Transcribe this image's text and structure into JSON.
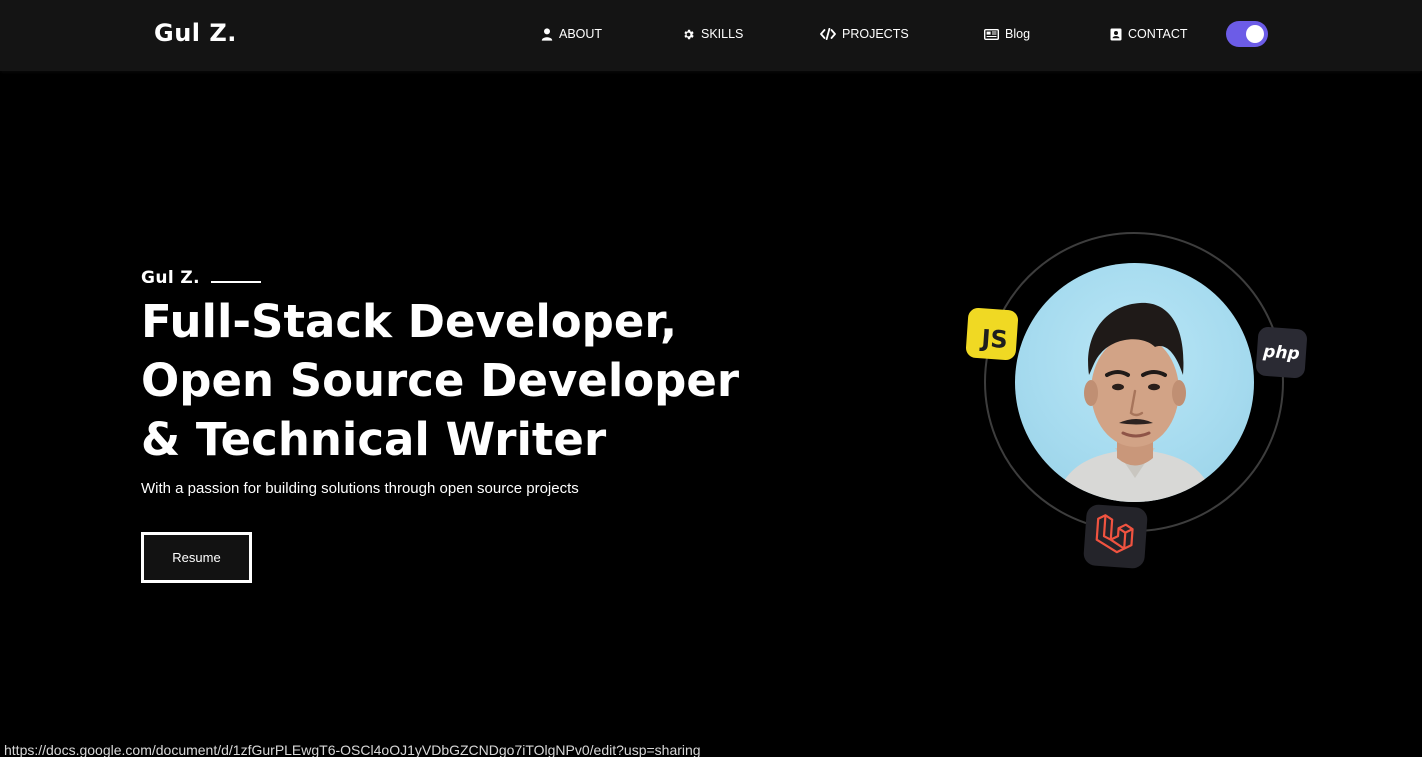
{
  "nav": {
    "brand": "Gul Z.",
    "items": [
      {
        "label": "ABOUT",
        "icon": "user-icon"
      },
      {
        "label": "SKILLS",
        "icon": "gear-icon"
      },
      {
        "label": "PROJECTS",
        "icon": "code-icon"
      },
      {
        "label": "Blog",
        "icon": "newspaper-icon"
      },
      {
        "label": "CONTACT",
        "icon": "address-card-icon"
      }
    ],
    "theme_toggle": {
      "state": "on",
      "color": "#6c5ce7"
    }
  },
  "hero": {
    "name": "Gul Z.",
    "headline": [
      "Full-Stack Developer,",
      "Open Source Developer",
      "& Technical Writer"
    ],
    "tagline": "With a passion for building solutions through open source projects",
    "resume_label": "Resume"
  },
  "avatar": {
    "photo": "profile-photo",
    "badges": [
      {
        "label": "JS",
        "icon": "javascript-icon",
        "color": "#f0d923"
      },
      {
        "label": "php",
        "icon": "php-icon",
        "color": "#2a2a33"
      },
      {
        "label": "",
        "icon": "laravel-icon",
        "color": "#f05340"
      }
    ]
  },
  "status_bar": {
    "url": "https://docs.google.com/document/d/1zfGurPLEwgT6-OSCl4oOJ1yVDbGZCNDgo7iTOlgNPv0/edit?usp=sharing"
  }
}
